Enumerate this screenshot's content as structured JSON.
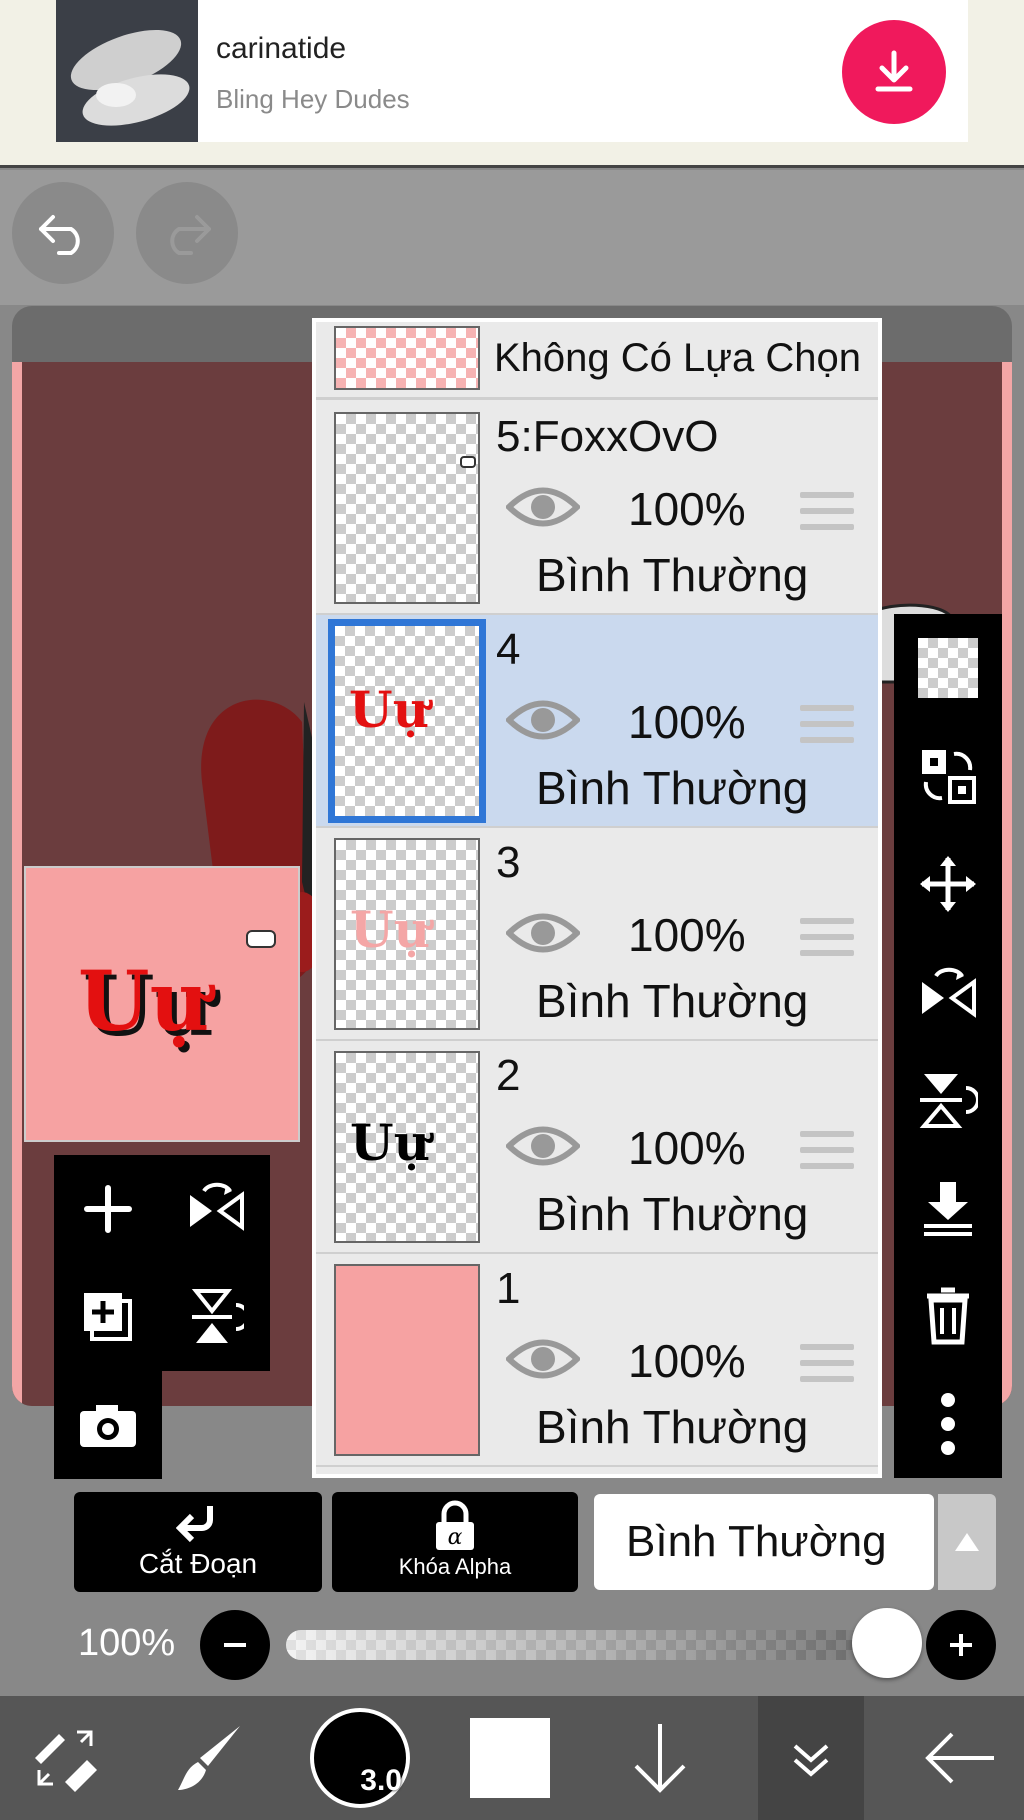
{
  "ad": {
    "title": "carinatide",
    "subtitle": "Bling Hey Dudes",
    "download_icon": "download-icon"
  },
  "toolbar_top": {
    "undo_icon": "undo-icon",
    "redo_icon": "redo-icon"
  },
  "layers": {
    "no_selection_label": "Không Có Lựa Chọn",
    "items": [
      {
        "name": "5:FoxxOvO",
        "opacity": "100%",
        "blend": "Bình Thường",
        "selected": false
      },
      {
        "name": "4",
        "opacity": "100%",
        "blend": "Bình Thường",
        "selected": true
      },
      {
        "name": "3",
        "opacity": "100%",
        "blend": "Bình Thường",
        "selected": false
      },
      {
        "name": "2",
        "opacity": "100%",
        "blend": "Bình Thường",
        "selected": false
      },
      {
        "name": "1",
        "opacity": "100%",
        "blend": "Bình Thường",
        "selected": false
      }
    ]
  },
  "thumb_text": {
    "layer4": "Uự",
    "layer3": "Uự",
    "layer2": "Uự",
    "preview": "Uự"
  },
  "bottom_panel": {
    "clip_label": "Cắt Đoạn",
    "alpha_lock_label": "Khóa Alpha",
    "blend_mode": "Bình Thường",
    "opacity_label": "100%",
    "opacity_value": 1.0
  },
  "bottom_bar": {
    "brush_size": "3.0"
  },
  "colors": {
    "ad_download": "#f0195c",
    "selected_layer_bg": "#cad9ee",
    "selected_border": "#2f76d6",
    "canvas_bg": "#6b3d3e",
    "layer1_fill": "#f6a2a2"
  }
}
